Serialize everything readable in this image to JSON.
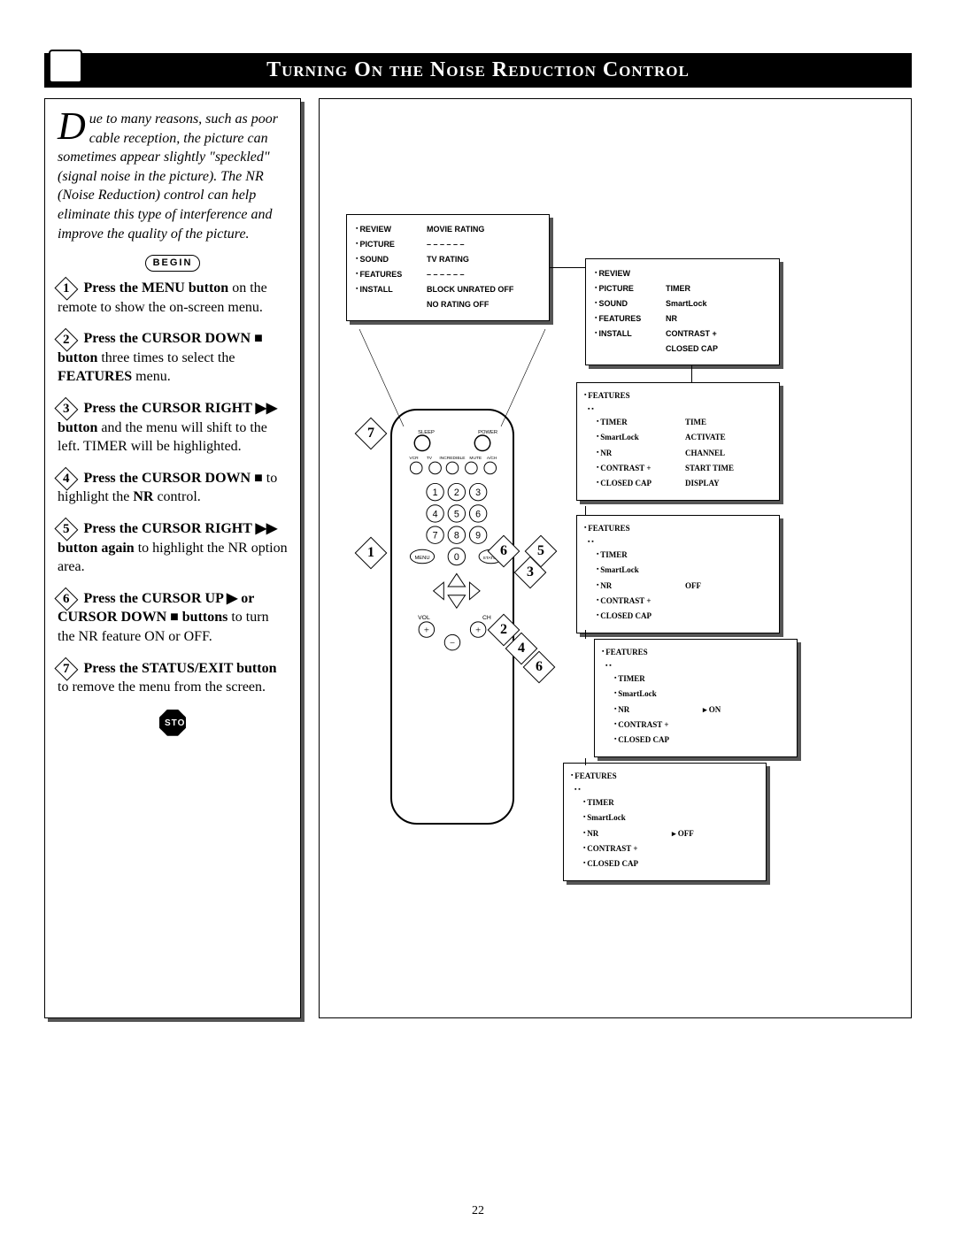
{
  "page_title": "Turning On the Noise Reduction Control",
  "page_number": "22",
  "intro": {
    "dropcap": "D",
    "text": "ue to many reasons, such as poor cable reception, the picture can sometimes appear slightly \"speckled\" (signal noise in the picture). The NR (Noise Reduction) control can help eliminate this type of interference and improve the quality of the picture."
  },
  "begin_label": "BEGIN",
  "stop_label": "STOP",
  "steps": [
    {
      "n": "1",
      "bold": "Press the MENU button",
      "rest": " on the remote to show the on-screen menu."
    },
    {
      "n": "2",
      "bold": "Press the CURSOR DOWN ■ button",
      "rest": " three times to select the ",
      "bold2": "FEATURES",
      "rest2": " menu."
    },
    {
      "n": "3",
      "bold": "Press the CURSOR RIGHT ▶▶ button",
      "rest": " and the menu will shift to the left. TIMER will be highlighted."
    },
    {
      "n": "4",
      "bold": "Press the CURSOR DOWN ■",
      "rest": " to highlight the ",
      "bold2": "NR",
      "rest2": " control."
    },
    {
      "n": "5",
      "bold": "Press the CURSOR RIGHT ▶▶ button again",
      "rest": " to highlight the NR option area."
    },
    {
      "n": "6",
      "bold": "Press the CURSOR UP ▶ or CURSOR DOWN ■ buttons",
      "rest": " to turn the NR feature ON or OFF."
    },
    {
      "n": "7",
      "bold": "Press the STATUS/EXIT button",
      "rest": " to remove the menu from the screen."
    }
  ],
  "main_menu": {
    "left": [
      "REVIEW",
      "PICTURE",
      "SOUND",
      "FEATURES",
      "INSTALL"
    ],
    "right": [
      "MOVIE RATING",
      "– – – – – –",
      "TV RATING",
      "– – – – – –",
      "BLOCK UNRATED   OFF",
      "NO RATING          OFF"
    ]
  },
  "features_menu": {
    "left": [
      "REVIEW",
      "PICTURE",
      "SOUND",
      "FEATURES",
      "INSTALL"
    ],
    "right": [
      "TIMER",
      "SmartLock",
      "NR",
      "CONTRAST +",
      "CLOSED CAP"
    ]
  },
  "submenu1": {
    "header": "FEATURES",
    "items": [
      {
        "l": "TIMER",
        "v": "TIME"
      },
      {
        "l": "SmartLock",
        "v": "ACTIVATE"
      },
      {
        "l": "NR",
        "v": "CHANNEL"
      },
      {
        "l": "CONTRAST +",
        "v": "START TIME"
      },
      {
        "l": "CLOSED CAP",
        "v": "DISPLAY"
      }
    ]
  },
  "submenu2": {
    "header": "FEATURES",
    "items": [
      {
        "l": "TIMER",
        "v": ""
      },
      {
        "l": "SmartLock",
        "v": ""
      },
      {
        "l": "NR",
        "v": "OFF"
      },
      {
        "l": "CONTRAST +",
        "v": ""
      },
      {
        "l": "CLOSED CAP",
        "v": ""
      }
    ]
  },
  "submenu3": {
    "header": "FEATURES",
    "items": [
      {
        "l": "TIMER",
        "v": ""
      },
      {
        "l": "SmartLock",
        "v": ""
      },
      {
        "l": "NR",
        "v": "▸ ON"
      },
      {
        "l": "CONTRAST +",
        "v": ""
      },
      {
        "l": "CLOSED CAP",
        "v": ""
      }
    ]
  },
  "submenu4": {
    "header": "FEATURES",
    "items": [
      {
        "l": "TIMER",
        "v": ""
      },
      {
        "l": "SmartLock",
        "v": ""
      },
      {
        "l": "NR",
        "v": "▸ OFF"
      },
      {
        "l": "CONTRAST +",
        "v": ""
      },
      {
        "l": "CLOSED CAP",
        "v": ""
      }
    ]
  },
  "callouts": [
    "1",
    "2",
    "3",
    "4",
    "5",
    "6",
    "7"
  ]
}
